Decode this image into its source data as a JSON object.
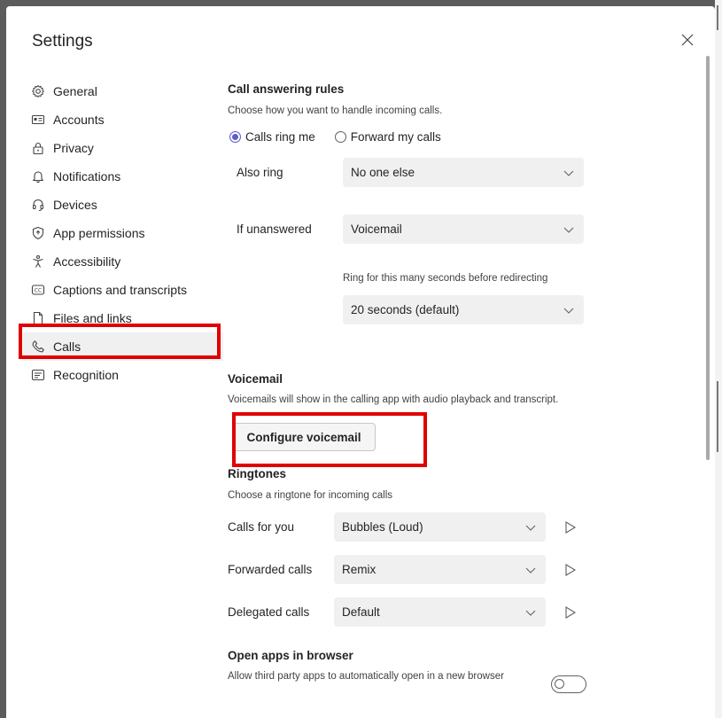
{
  "dialog": {
    "title": "Settings"
  },
  "sidebar": {
    "items": [
      {
        "label": "General",
        "icon": "gear-icon"
      },
      {
        "label": "Accounts",
        "icon": "id-card-icon"
      },
      {
        "label": "Privacy",
        "icon": "lock-icon"
      },
      {
        "label": "Notifications",
        "icon": "bell-icon"
      },
      {
        "label": "Devices",
        "icon": "headset-icon"
      },
      {
        "label": "App permissions",
        "icon": "shield-icon"
      },
      {
        "label": "Accessibility",
        "icon": "accessibility-icon"
      },
      {
        "label": "Captions and transcripts",
        "icon": "cc-icon"
      },
      {
        "label": "Files and links",
        "icon": "file-icon"
      },
      {
        "label": "Calls",
        "icon": "phone-icon",
        "active": true
      },
      {
        "label": "Recognition",
        "icon": "recognition-icon"
      }
    ]
  },
  "call_answering": {
    "title": "Call answering rules",
    "description": "Choose how you want to handle incoming calls.",
    "radio_ring_me": "Calls ring me",
    "radio_forward": "Forward my calls",
    "also_ring_label": "Also ring",
    "also_ring_value": "No one else",
    "if_unanswered_label": "If unanswered",
    "if_unanswered_value": "Voicemail",
    "ring_seconds_label": "Ring for this many seconds before redirecting",
    "ring_seconds_value": "20 seconds (default)"
  },
  "voicemail": {
    "title": "Voicemail",
    "description": "Voicemails will show in the calling app with audio playback and transcript.",
    "button": "Configure voicemail"
  },
  "ringtones": {
    "title": "Ringtones",
    "description": "Choose a ringtone for incoming calls",
    "rows": [
      {
        "label": "Calls for you",
        "value": "Bubbles (Loud)"
      },
      {
        "label": "Forwarded calls",
        "value": "Remix"
      },
      {
        "label": "Delegated calls",
        "value": "Default"
      }
    ]
  },
  "open_apps": {
    "title": "Open apps in browser",
    "description": "Allow third party apps to automatically open in a new browser"
  },
  "colors": {
    "accent": "#5b5fc7",
    "highlight": "#e00000"
  }
}
